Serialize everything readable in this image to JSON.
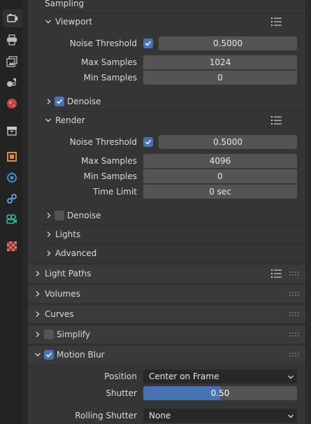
{
  "tabs": [
    {
      "icon": "render-camera-icon",
      "active": true
    },
    {
      "icon": "output-printer-icon"
    },
    {
      "icon": "view-layer-icon"
    },
    {
      "icon": "scene-icon"
    },
    {
      "icon": "world-icon"
    },
    {
      "icon": "collection-icon"
    },
    {
      "icon": "object-icon"
    },
    {
      "icon": "physics-icon"
    },
    {
      "icon": "object-constraint-icon"
    },
    {
      "icon": "object-data-icon"
    },
    {
      "icon": "texture-icon"
    }
  ],
  "sampling": {
    "title": "Sampling",
    "viewport": {
      "title": "Viewport",
      "noise_threshold_label": "Noise Threshold",
      "noise_threshold_enabled": true,
      "noise_threshold_value": "0.5000",
      "max_samples_label": "Max Samples",
      "max_samples_value": "1024",
      "min_samples_label": "Min Samples",
      "min_samples_value": "0",
      "denoise_label": "Denoise",
      "denoise_enabled": true
    },
    "render": {
      "title": "Render",
      "noise_threshold_label": "Noise Threshold",
      "noise_threshold_enabled": true,
      "noise_threshold_value": "0.5000",
      "max_samples_label": "Max Samples",
      "max_samples_value": "4096",
      "min_samples_label": "Min Samples",
      "min_samples_value": "0",
      "time_limit_label": "Time Limit",
      "time_limit_value": "0 sec",
      "denoise_label": "Denoise",
      "denoise_enabled": false
    },
    "lights_label": "Lights",
    "advanced_label": "Advanced"
  },
  "light_paths": {
    "title": "Light Paths"
  },
  "volumes": {
    "title": "Volumes"
  },
  "curves": {
    "title": "Curves"
  },
  "simplify": {
    "title": "Simplify",
    "enabled": false
  },
  "motion_blur": {
    "title": "Motion Blur",
    "enabled": true,
    "position_label": "Position",
    "position_value": "Center on Frame",
    "shutter_label": "Shutter",
    "shutter_value": "0.50",
    "shutter_fraction": 0.5,
    "rolling_shutter_label": "Rolling Shutter",
    "rolling_shutter_value": "None"
  },
  "colors": {
    "accent": "#4772b3",
    "field": "#545454",
    "panel": "#353535",
    "header": "#3a3a3a"
  }
}
